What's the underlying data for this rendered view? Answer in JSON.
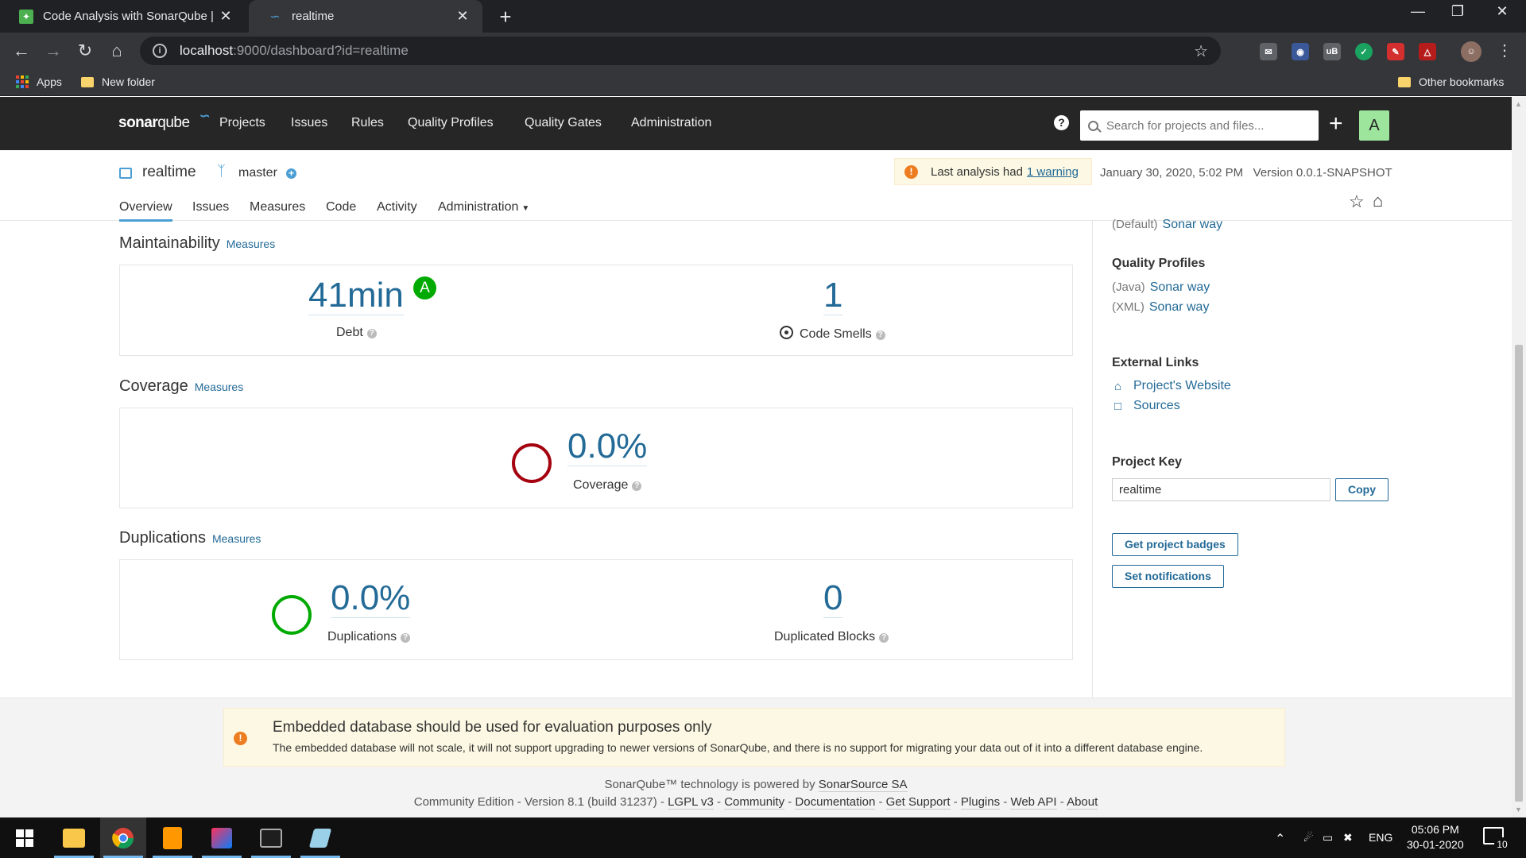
{
  "browser": {
    "tabs": [
      {
        "title": "Code Analysis with SonarQube | I",
        "active": false
      },
      {
        "title": "realtime",
        "active": true
      }
    ],
    "url": {
      "host": "localhost",
      "rest": ":9000/dashboard?id=realtime"
    },
    "bookmarks": {
      "apps": "Apps",
      "folder": "New folder",
      "other": "Other bookmarks"
    }
  },
  "sonar": {
    "logo": {
      "bold": "sonar",
      "thin": "qube"
    },
    "menu": [
      "Projects",
      "Issues",
      "Rules",
      "Quality Profiles",
      "Quality Gates",
      "Administration"
    ],
    "search_placeholder": "Search for projects and files...",
    "avatar": "A"
  },
  "project": {
    "name": "realtime",
    "branch": "master",
    "warning_prefix": "Last analysis had",
    "warning_link": "1 warning",
    "analysis_date": "January 30, 2020, 5:02 PM",
    "version": "Version 0.0.1-SNAPSHOT",
    "tabs": [
      "Overview",
      "Issues",
      "Measures",
      "Code",
      "Activity",
      "Administration"
    ],
    "active_tab": "Overview"
  },
  "maintainability": {
    "title": "Maintainability",
    "link": "Measures",
    "debt_value": "41min",
    "debt_label": "Debt",
    "rating": "A",
    "smells_value": "1",
    "smells_label": "Code Smells"
  },
  "coverage": {
    "title": "Coverage",
    "link": "Measures",
    "value": "0.0%",
    "label": "Coverage",
    "ring_color": "#a4030f"
  },
  "duplications": {
    "title": "Duplications",
    "link": "Measures",
    "value": "0.0%",
    "label": "Duplications",
    "ring_color": "#00aa00",
    "blocks_value": "0",
    "blocks_label": "Duplicated Blocks"
  },
  "sidebar": {
    "default_prefix": "(Default)",
    "default_gate": "Sonar way",
    "qp_title": "Quality Profiles",
    "profiles": [
      {
        "lang": "(Java)",
        "name": "Sonar way"
      },
      {
        "lang": "(XML)",
        "name": "Sonar way"
      }
    ],
    "links_title": "External Links",
    "website": "Project's Website",
    "sources": "Sources",
    "key_title": "Project Key",
    "key_value": "realtime",
    "copy": "Copy",
    "badges": "Get project badges",
    "notifications": "Set notifications"
  },
  "footer": {
    "warn_title": "Embedded database should be used for evaluation purposes only",
    "warn_body": "The embedded database will not scale, it will not support upgrading to newer versions of SonarQube, and there is no support for migrating your data out of it into a different database engine.",
    "powered_prefix": "SonarQube™ technology is powered by",
    "powered_link": "SonarSource SA",
    "edition": "Community Edition - Version 8.1 (build 31237) -",
    "links": [
      "LGPL v3",
      "Community",
      "Documentation",
      "Get Support",
      "Plugins",
      "Web API",
      "About"
    ]
  },
  "taskbar": {
    "lang": "ENG",
    "time": "05:06 PM",
    "date": "30-01-2020",
    "notifications": "10"
  },
  "colors": {
    "accent": "#236a97",
    "nav": "#262626",
    "rating_a": "#00aa00",
    "warning": "#ed7d20"
  }
}
